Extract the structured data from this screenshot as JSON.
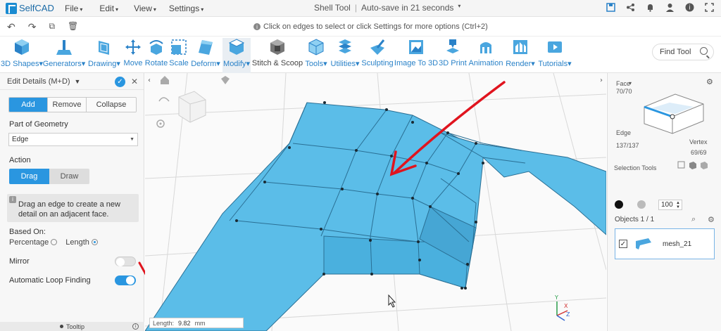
{
  "app": {
    "logo_text": "SelfCAD",
    "menu": [
      "File",
      "Edit",
      "View",
      "Settings"
    ],
    "document_title": "Shell Tool",
    "autosave": "Auto-save in 21 seconds"
  },
  "subbar": {
    "hint": "Click on edges to select or click Settings for more options (Ctrl+2)"
  },
  "ribbon": {
    "tools": [
      {
        "label": "3D Shapes",
        "icon": "cube-icon",
        "caret": true
      },
      {
        "label": "Generators",
        "icon": "generator-icon",
        "caret": true
      },
      {
        "label": "Drawing",
        "icon": "drawing-icon",
        "caret": true
      },
      {
        "label": "Move",
        "icon": "move-icon",
        "caret": false
      },
      {
        "label": "Rotate",
        "icon": "rotate-icon",
        "caret": false
      },
      {
        "label": "Scale",
        "icon": "scale-icon",
        "caret": false
      },
      {
        "label": "Deform",
        "icon": "deform-icon",
        "caret": true
      },
      {
        "label": "Modify",
        "icon": "modify-icon",
        "caret": true
      },
      {
        "label": "Stitch & Scoop",
        "icon": "stitch-scoop-icon",
        "caret": false
      },
      {
        "label": "Tools",
        "icon": "tools-icon",
        "caret": true
      },
      {
        "label": "Utilities",
        "icon": "utilities-icon",
        "caret": true
      },
      {
        "label": "Sculpting",
        "icon": "sculpting-icon",
        "caret": false
      },
      {
        "label": "Image To 3D",
        "icon": "image-to-3d-icon",
        "caret": false
      },
      {
        "label": "3D Print",
        "icon": "3d-print-icon",
        "caret": false
      },
      {
        "label": "Animation",
        "icon": "animation-icon",
        "caret": false
      },
      {
        "label": "Render",
        "icon": "render-icon",
        "caret": true
      },
      {
        "label": "Tutorials",
        "icon": "tutorials-icon",
        "caret": true
      }
    ],
    "find_tool_placeholder": "Find Tool"
  },
  "left_panel": {
    "title": "Edit Details (M+D)",
    "mode_tabs": [
      "Add",
      "Remove",
      "Collapse"
    ],
    "active_mode": "Add",
    "part_of_geometry_label": "Part of Geometry",
    "part_of_geometry_value": "Edge",
    "action_label": "Action",
    "action_tabs": [
      "Drag",
      "Draw"
    ],
    "active_action": "Drag",
    "tip_text": "Drag an edge to create a new detail on an adjacent face.",
    "based_on_label": "Based On:",
    "based_on_options": [
      "Percentage",
      "Length"
    ],
    "based_on_selected": "Length",
    "mirror_label": "Mirror",
    "mirror_on": false,
    "auto_loop_label": "Automatic Loop Finding",
    "auto_loop_on": true,
    "footer": "Tooltip"
  },
  "viewport": {
    "length_label": "Length:",
    "length_value": "9.82",
    "length_unit": "mm",
    "axis_labels": [
      "Y",
      "X",
      "Z"
    ],
    "mesh_color": "#5bbde8",
    "annotation_color": "#e0141e"
  },
  "right_panel": {
    "face_label": "Face",
    "face_count": "70/70",
    "edge_label": "Edge",
    "edge_count": "137/137",
    "vertex_label": "Vertex",
    "vertex_count": "69/69",
    "selection_tools_label": "Selection Tools",
    "opacity_value": "100",
    "objects_label": "Objects 1 / 1",
    "object_name": "mesh_21"
  },
  "colors": {
    "accent": "#2a96e0",
    "ribbon_label": "#2a82c8"
  }
}
